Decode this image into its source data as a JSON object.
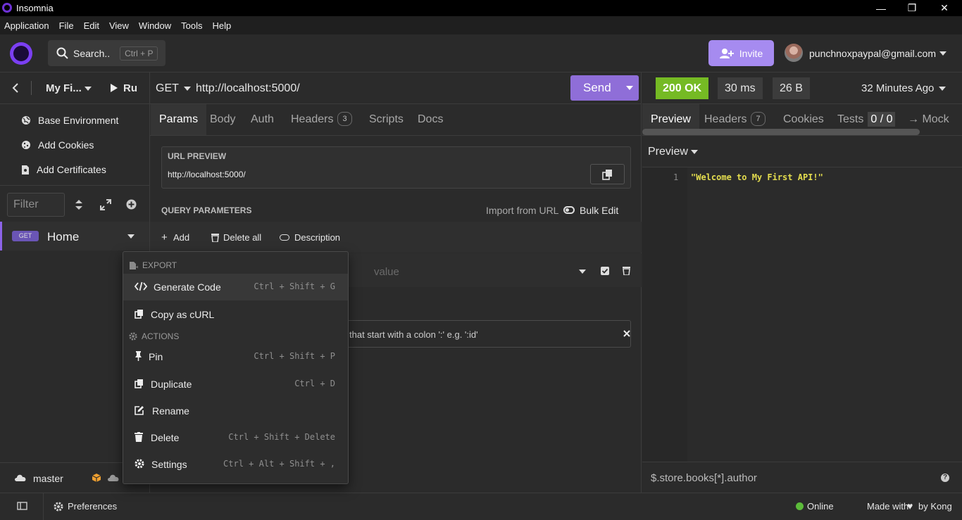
{
  "window": {
    "title": "Insomnia",
    "minimize": "—",
    "restore": "❐",
    "close": "✕"
  },
  "menubar": [
    "Application",
    "File",
    "Edit",
    "View",
    "Window",
    "Tools",
    "Help"
  ],
  "header": {
    "search_label": "Search..",
    "search_shortcut": "Ctrl + P",
    "invite_label": "Invite",
    "user_email": "punchnoxpaypal@gmail.com"
  },
  "sidebar": {
    "project_name": "My Fi...",
    "run_label": "Ru",
    "links": [
      "Base Environment",
      "Add Cookies",
      "Add Certificates"
    ],
    "filter_placeholder": "Filter",
    "request": {
      "method": "GET",
      "name": "Home"
    }
  },
  "request": {
    "method": "GET",
    "url": "http://localhost:5000/",
    "send_label": "Send",
    "tabs": [
      {
        "label": "Params"
      },
      {
        "label": "Body"
      },
      {
        "label": "Auth"
      },
      {
        "label": "Headers",
        "count": "3"
      },
      {
        "label": "Scripts"
      },
      {
        "label": "Docs"
      }
    ],
    "url_preview_title": "URL PREVIEW",
    "url_preview_value": "http://localhost:5000/",
    "query_title": "QUERY PARAMETERS",
    "import_label": "Import from URL",
    "bulk_edit_label": "Bulk Edit",
    "add_label": "Add",
    "delete_all_label": "Delete all",
    "description_label": "Description",
    "value_placeholder": "value",
    "hint_text": "that start with a colon ':' e.g. ':id'"
  },
  "response": {
    "status": "200 OK",
    "status_color": "#75ba24",
    "time": "30 ms",
    "size": "26 B",
    "ago": "32 Minutes Ago",
    "tabs": [
      {
        "label": "Preview"
      },
      {
        "label": "Headers",
        "count": "7"
      },
      {
        "label": "Cookies"
      },
      {
        "label": "Tests",
        "count": "0 / 0"
      },
      {
        "label": "→ Mock"
      }
    ],
    "preview_mode": "Preview",
    "line_number": "1",
    "body": "\"Welcome to My First API!\"",
    "filter_placeholder": "$.store.books[*].author"
  },
  "footer": {
    "branch": "master",
    "preferences": "Preferences",
    "online": "Online",
    "made_with": "Made with",
    "by_kong": "by Kong"
  },
  "context_menu": {
    "export_header": "EXPORT",
    "actions_header": "ACTIONS",
    "items": [
      {
        "label": "Generate Code",
        "shortcut": "Ctrl + Shift + G"
      },
      {
        "label": "Copy as cURL",
        "shortcut": ""
      },
      {
        "label": "Pin",
        "shortcut": "Ctrl + Shift + P"
      },
      {
        "label": "Duplicate",
        "shortcut": "Ctrl + D"
      },
      {
        "label": "Rename",
        "shortcut": ""
      },
      {
        "label": "Delete",
        "shortcut": "Ctrl + Shift + Delete"
      },
      {
        "label": "Settings",
        "shortcut": "Ctrl + Alt + Shift + ,"
      }
    ]
  }
}
